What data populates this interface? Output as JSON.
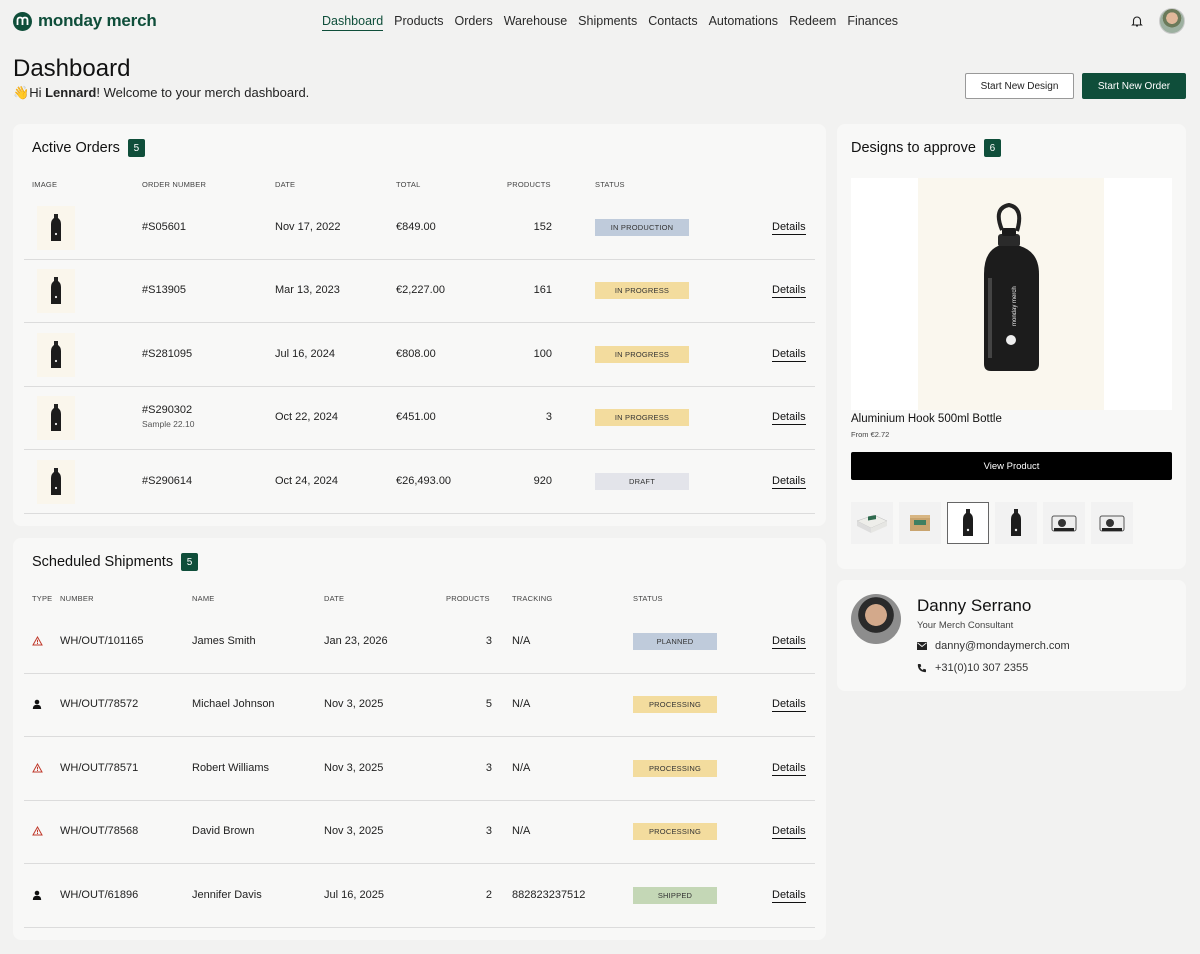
{
  "brand": {
    "name": "monday merch",
    "color": "#0f4e3a"
  },
  "nav": {
    "items": [
      "Dashboard",
      "Products",
      "Orders",
      "Warehouse",
      "Shipments",
      "Contacts",
      "Automations",
      "Redeem",
      "Finances"
    ],
    "active": "Dashboard"
  },
  "header": {
    "title": "Dashboard",
    "wave": "👋",
    "greeting_prefix": "Hi ",
    "user": "Lennard",
    "greeting_suffix": "! Welcome to your merch dashboard.",
    "start_design": "Start New Design",
    "start_order": "Start New Order"
  },
  "active_orders": {
    "title": "Active Orders",
    "count": "5",
    "columns": [
      "IMAGE",
      "ORDER NUMBER",
      "DATE",
      "TOTAL",
      "PRODUCTS",
      "STATUS"
    ],
    "rows": [
      {
        "number": "#S05601",
        "sub": "",
        "date": "Nov 17, 2022",
        "total": "€849.00",
        "products": "152",
        "status": "IN PRODUCTION",
        "status_color": "blue",
        "action": "Details"
      },
      {
        "number": "#S13905",
        "sub": "",
        "date": "Mar 13, 2023",
        "total": "€2,227.00",
        "products": "161",
        "status": "IN PROGRESS",
        "status_color": "yellow",
        "action": "Details"
      },
      {
        "number": "#S281095",
        "sub": "",
        "date": "Jul 16, 2024",
        "total": "€808.00",
        "products": "100",
        "status": "IN PROGRESS",
        "status_color": "yellow",
        "action": "Details"
      },
      {
        "number": "#S290302",
        "sub": "Sample 22.10",
        "date": "Oct 22, 2024",
        "total": "€451.00",
        "products": "3",
        "status": "IN PROGRESS",
        "status_color": "yellow",
        "action": "Details"
      },
      {
        "number": "#S290614",
        "sub": "",
        "date": "Oct 24, 2024",
        "total": "€26,493.00",
        "products": "920",
        "status": "DRAFT",
        "status_color": "grey",
        "action": "Details"
      }
    ]
  },
  "shipments": {
    "title": "Scheduled Shipments",
    "count": "5",
    "columns": [
      "TYPE",
      "NUMBER",
      "NAME",
      "DATE",
      "PRODUCTS",
      "TRACKING",
      "STATUS"
    ],
    "rows": [
      {
        "type_icon": "warning-icon",
        "number": "WH/OUT/101165",
        "name": "James Smith",
        "date": "Jan 23, 2026",
        "products": "3",
        "tracking": "N/A",
        "status": "PLANNED",
        "status_color": "blue",
        "action": "Details"
      },
      {
        "type_icon": "person-icon",
        "number": "WH/OUT/78572",
        "name": "Michael Johnson",
        "date": "Nov 3, 2025",
        "products": "5",
        "tracking": "N/A",
        "status": "PROCESSING",
        "status_color": "yellow",
        "action": "Details"
      },
      {
        "type_icon": "warning-icon",
        "number": "WH/OUT/78571",
        "name": "Robert Williams",
        "date": "Nov 3, 2025",
        "products": "3",
        "tracking": "N/A",
        "status": "PROCESSING",
        "status_color": "yellow",
        "action": "Details"
      },
      {
        "type_icon": "warning-icon",
        "number": "WH/OUT/78568",
        "name": "David Brown",
        "date": "Nov 3, 2025",
        "products": "3",
        "tracking": "N/A",
        "status": "PROCESSING",
        "status_color": "yellow",
        "action": "Details"
      },
      {
        "type_icon": "person-icon",
        "number": "WH/OUT/61896",
        "name": "Jennifer Davis",
        "date": "Jul 16, 2025",
        "products": "2",
        "tracking": "882823237512",
        "status": "SHIPPED",
        "status_color": "green",
        "action": "Details"
      }
    ]
  },
  "designs": {
    "title": "Designs to approve",
    "count": "6",
    "product_name": "Aluminium Hook 500ml Bottle",
    "price": "From €2.72",
    "view_button": "View Product",
    "thumbnails": [
      "box-icon",
      "kraft-box-icon",
      "bottle-icon",
      "bottle-icon",
      "camera-icon",
      "camera-icon"
    ],
    "selected_thumbnail": 2
  },
  "consultant": {
    "name": "Danny Serrano",
    "role": "Your Merch Consultant",
    "email": "danny@mondaymerch.com",
    "phone": "+31(0)10 307 2355"
  }
}
